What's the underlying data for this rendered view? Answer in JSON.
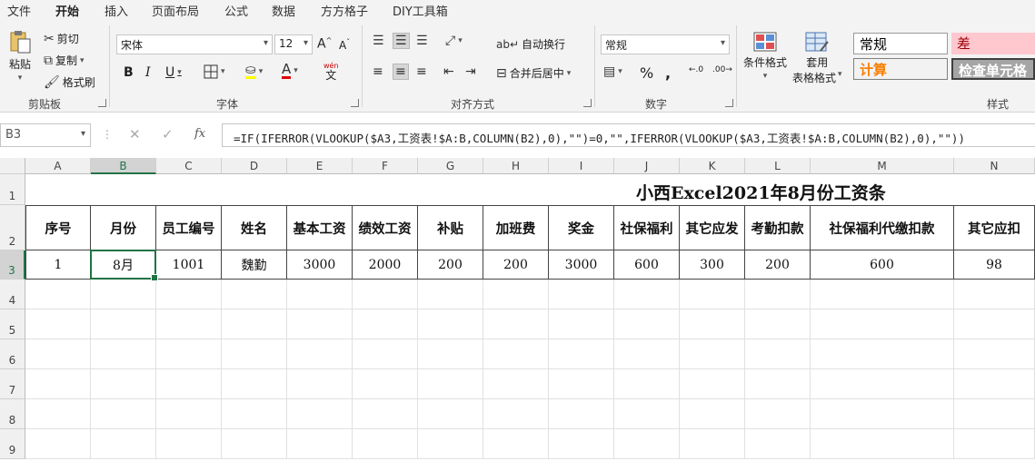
{
  "menu": {
    "tabs": [
      "文件",
      "开始",
      "插入",
      "页面布局",
      "公式",
      "数据",
      "方方格子",
      "DIY工具箱"
    ],
    "active": "开始"
  },
  "ribbon": {
    "clipboard": {
      "paste": "粘贴",
      "cut": "剪切",
      "copy": "复制",
      "format_painter": "格式刷",
      "group": "剪贴板"
    },
    "font": {
      "name": "宋体",
      "size": "12",
      "bold": "B",
      "italic": "I",
      "underline": "U",
      "phonetic": "wén",
      "phonetic_sub": "文",
      "group": "字体"
    },
    "alignment": {
      "wrap": "自动换行",
      "merge": "合并后居中",
      "group": "对齐方式"
    },
    "number": {
      "format": "常规",
      "group": "数字"
    },
    "styles": {
      "conditional": "条件格式",
      "table_l1": "套用",
      "table_l2": "表格格式",
      "group": "样式",
      "cells": [
        {
          "text": "常规",
          "bg": "#ffffff",
          "fg": "#000000"
        },
        {
          "text": "差",
          "bg": "#ffc7ce",
          "fg": "#9c0006"
        },
        {
          "text": "计算",
          "bg": "#f2f2f2",
          "fg": "#fa7d00"
        },
        {
          "text": "检查单元格",
          "bg": "#a5a5a5",
          "fg": "#ffffff"
        }
      ]
    }
  },
  "formula_bar": {
    "name_box": "B3",
    "fx": "fx",
    "formula": "=IF(IFERROR(VLOOKUP($A3,工资表!$A:B,COLUMN(B2),0),\"\")=0,\"\",IFERROR(VLOOKUP($A3,工资表!$A:B,COLUMN(B2),0),\"\"))"
  },
  "sheet": {
    "columns": [
      "A",
      "B",
      "C",
      "D",
      "E",
      "F",
      "G",
      "H",
      "I",
      "J",
      "K",
      "L",
      "M",
      "N"
    ],
    "rows": [
      "1",
      "2",
      "3",
      "4",
      "5",
      "6",
      "7",
      "8",
      "9"
    ],
    "title": "小西Excel2021年8月份工资条",
    "headers": [
      "序号",
      "月份",
      "员工编号",
      "姓名",
      "基本工资",
      "绩效工资",
      "补贴",
      "加班费",
      "奖金",
      "社保福利",
      "其它应发",
      "考勤扣款",
      "社保福利代缴扣款",
      "其它应扣"
    ],
    "row3": [
      "1",
      "8月",
      "1001",
      "魏勤",
      "3000",
      "2000",
      "200",
      "200",
      "3000",
      "600",
      "300",
      "200",
      "600",
      "98"
    ],
    "active_cell": "B3",
    "colors": {
      "accent": "#217346"
    }
  }
}
